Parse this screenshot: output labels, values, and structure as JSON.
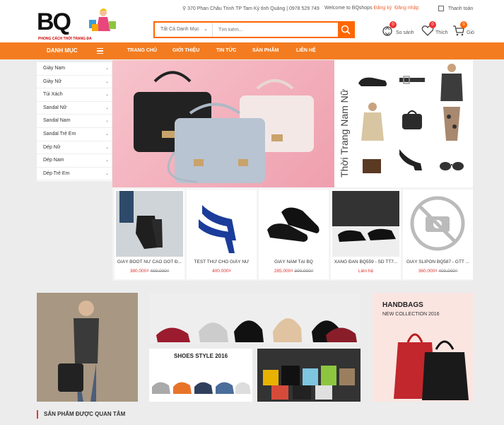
{
  "header": {
    "logo_text": "BQ",
    "logo_tagline": "PHONG CÁCH THỜI TRANG ĐA",
    "address": "370 Phan Châu Trinh TP Tam Kỳ tỉnh Quảng",
    "phone": "0978 529 749",
    "welcome": "Welcome to BQshops",
    "register": "Đăng ký",
    "login": "Đăng nhập",
    "checkout": "Thanh toán",
    "search_category": "Tất Cả Danh Mục",
    "search_placeholder": "Tìm kiếm...",
    "compare_label": "So sánh",
    "compare_count": "0",
    "wishlist_label": "Thích",
    "wishlist_count": "0",
    "cart_label": "Giỏ",
    "cart_count": "0"
  },
  "nav": {
    "category_label": "DANH MỤC",
    "items": [
      "TRANG CHỦ",
      "GIỚI THIỆU",
      "TIN TỨC",
      "SẢN PHẨM",
      "LIÊN HỆ"
    ]
  },
  "sidebar": {
    "items": [
      "Giày Nam",
      "Giày Nữ",
      "Túi Xách",
      "Sandal Nữ",
      "Sandal Nam",
      "Sandal Trẻ Em",
      "Dép Nữ",
      "Dép Nam",
      "Dép Trẻ Em"
    ]
  },
  "banner2": {
    "vertical_text": "Thời Trang Nam Nữ"
  },
  "products": [
    {
      "name": "GIÀY BOOT NỮ CAO GÓT Đ...",
      "price": "380.000₫",
      "old_price": "400.000₫"
    },
    {
      "name": "TEST THỬ CHO GIẦY NỮ",
      "price": "400.000₫",
      "old_price": ""
    },
    {
      "name": "GIÀY NAM TẠI BQ",
      "price": "285.000₫",
      "old_price": "300.000₫"
    },
    {
      "name": "XĂNG ĐAN BQ559 - SD TT7...",
      "price": "Liên hệ",
      "old_price": ""
    },
    {
      "name": "GIÀY SLIPON BQ587 - GTT ...",
      "price": "360.000₫",
      "old_price": "400.000₫"
    }
  ],
  "promo": {
    "shoes_style": "SHOES STYLE 2016",
    "handbags_title": "HANDBAGS",
    "handbags_sub": "NEW COLLECTION 2016"
  },
  "section_title": "SẢN PHẨM ĐƯỢC QUAN TÂM",
  "colors": {
    "accent": "#f47c20",
    "badge": "#e33333",
    "price": "#dd3333"
  }
}
